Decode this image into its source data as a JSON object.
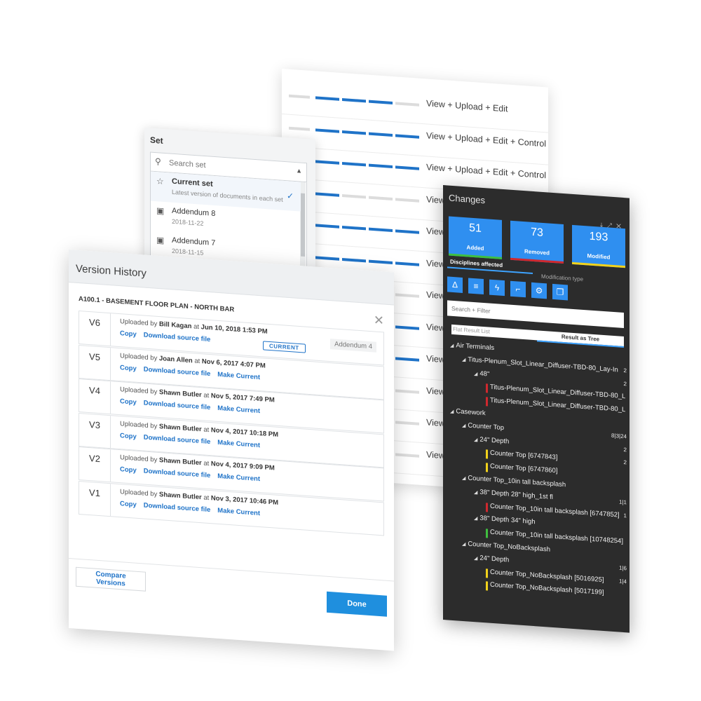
{
  "permissions": {
    "rows": [
      {
        "label": "View + Upload + Edit",
        "level": 0.75
      },
      {
        "label": "View + Upload + Edit + Control",
        "level": 1.0
      },
      {
        "label": "View + Upload + Edit + Control",
        "level": 1.0
      },
      {
        "label": "View",
        "level": 0.25
      },
      {
        "label": "View",
        "level": 1.0
      },
      {
        "label": "View",
        "level": 1.0
      },
      {
        "label": "View",
        "level": 0.5
      },
      {
        "label": "View",
        "level": 1.0
      },
      {
        "label": "View",
        "level": 1.0
      },
      {
        "label": "View",
        "level": 0.25
      },
      {
        "label": "View",
        "level": 0.5
      },
      {
        "label": "View",
        "level": 0.5
      }
    ]
  },
  "set_panel": {
    "title": "Set",
    "search_placeholder": "Search set",
    "items": [
      {
        "name": "Current set",
        "sub": "Latest version of documents in each set",
        "icon": "star-icon",
        "selected": true
      },
      {
        "name": "Addendum 8",
        "sub": "2018-11-22",
        "icon": "document-stack-icon",
        "selected": false
      },
      {
        "name": "Addendum 7",
        "sub": "2018-11-15",
        "icon": "document-stack-icon",
        "selected": false
      }
    ]
  },
  "version_history": {
    "title": "Version History",
    "file_name": "A100.1 - BASEMENT FLOOR PLAN - NORTH BAR",
    "versions": [
      {
        "v": "V6",
        "prefix": "Uploaded by",
        "user": "Bill Kagan",
        "at": "at",
        "date": "Jun 10, 2018 1:53 PM",
        "copy": "Copy",
        "download": "Download source file",
        "make_current": "",
        "badge": "CURRENT",
        "addendum": "Addendum 4"
      },
      {
        "v": "V5",
        "prefix": "Uploaded by",
        "user": "Joan Allen",
        "at": "at",
        "date": "Nov 6, 2017 4:07 PM",
        "copy": "Copy",
        "download": "Download source file",
        "make_current": "Make Current",
        "badge": "",
        "addendum": ""
      },
      {
        "v": "V4",
        "prefix": "Uploaded by",
        "user": "Shawn Butler",
        "at": "at",
        "date": "Nov 5, 2017 7:49 PM",
        "copy": "Copy",
        "download": "Download source file",
        "make_current": "Make Current",
        "badge": "",
        "addendum": ""
      },
      {
        "v": "V3",
        "prefix": "Uploaded by",
        "user": "Shawn Butler",
        "at": "at",
        "date": "Nov 4, 2017 10:18 PM",
        "copy": "Copy",
        "download": "Download source file",
        "make_current": "Make Current",
        "badge": "",
        "addendum": ""
      },
      {
        "v": "V2",
        "prefix": "Uploaded by",
        "user": "Shawn Butler",
        "at": "at",
        "date": "Nov 4, 2017 9:09 PM",
        "copy": "Copy",
        "download": "Download source file",
        "make_current": "Make Current",
        "badge": "",
        "addendum": ""
      },
      {
        "v": "V1",
        "prefix": "Uploaded by",
        "user": "Shawn Butler",
        "at": "at",
        "date": "Nov 3, 2017 10:46 PM",
        "copy": "Copy",
        "download": "Download source file",
        "make_current": "Make Current",
        "badge": "",
        "addendum": ""
      }
    ],
    "compare_label": "Compare Versions",
    "done_label": "Done"
  },
  "changes": {
    "title": "Changes",
    "stats": [
      {
        "value": "51",
        "label": "Added",
        "color": "#3fbf3f"
      },
      {
        "value": "73",
        "label": "Removed",
        "color": "#d0282e"
      },
      {
        "value": "193",
        "label": "Modified",
        "color": "#f2d21b"
      }
    ],
    "tabs": {
      "disciplines": "Disciplines affected",
      "modification": "Modification type"
    },
    "discipline_icons": [
      "architecture-icon",
      "structure-icon",
      "electrical-icon",
      "plumbing-icon",
      "mechanical-icon",
      "fire-protection-icon"
    ],
    "search_placeholder": "Search + Filter",
    "result_tabs": {
      "flat": "Flat Result List",
      "tree": "Result as Tree"
    },
    "tree": [
      {
        "label": "Air Terminals",
        "indent": 0,
        "arrow": true,
        "marker": "",
        "count": ""
      },
      {
        "label": "Titus-Plenum_Slot_Linear_Diffuser-TBD-80_Lay-In",
        "indent": 1,
        "arrow": true,
        "marker": "",
        "count": "2"
      },
      {
        "label": "48\"",
        "indent": 2,
        "arrow": true,
        "marker": "",
        "count": "2"
      },
      {
        "label": "Titus-Plenum_Slot_Linear_Diffuser-TBD-80_L",
        "indent": 3,
        "arrow": false,
        "marker": "#d0282e",
        "count": ""
      },
      {
        "label": "Titus-Plenum_Slot_Linear_Diffuser-TBD-80_L",
        "indent": 3,
        "arrow": false,
        "marker": "#d0282e",
        "count": ""
      },
      {
        "label": "Casework",
        "indent": 0,
        "arrow": true,
        "marker": "",
        "count": ""
      },
      {
        "label": "Counter Top",
        "indent": 1,
        "arrow": true,
        "marker": "",
        "count": "8|3|24"
      },
      {
        "label": "24\" Depth",
        "indent": 2,
        "arrow": true,
        "marker": "",
        "count": "2"
      },
      {
        "label": "Counter Top [6747843]",
        "indent": 3,
        "arrow": false,
        "marker": "#f2d21b",
        "count": "2"
      },
      {
        "label": "Counter Top [6747860]",
        "indent": 3,
        "arrow": false,
        "marker": "#f2d21b",
        "count": ""
      },
      {
        "label": "Counter Top_10in tall backsplash",
        "indent": 1,
        "arrow": true,
        "marker": "",
        "count": ""
      },
      {
        "label": "38\" Depth 28\" high_1st fl",
        "indent": 2,
        "arrow": true,
        "marker": "",
        "count": "1|1"
      },
      {
        "label": "Counter Top_10in tall backsplash [6747852]",
        "indent": 3,
        "arrow": false,
        "marker": "#d0282e",
        "count": "1"
      },
      {
        "label": "38\" Depth 34\" high",
        "indent": 2,
        "arrow": true,
        "marker": "",
        "count": ""
      },
      {
        "label": "Counter Top_10in tall backsplash [10748254]",
        "indent": 3,
        "arrow": false,
        "marker": "#3fbf3f",
        "count": ""
      },
      {
        "label": "Counter Top_NoBacksplash",
        "indent": 1,
        "arrow": true,
        "marker": "",
        "count": ""
      },
      {
        "label": "24\" Depth",
        "indent": 2,
        "arrow": true,
        "marker": "",
        "count": "1|6"
      },
      {
        "label": "Counter Top_NoBacksplash [5016925]",
        "indent": 3,
        "arrow": false,
        "marker": "#f2d21b",
        "count": "1|4"
      },
      {
        "label": "Counter Top_NoBacksplash [5017199]",
        "indent": 3,
        "arrow": false,
        "marker": "#f2d21b",
        "count": ""
      }
    ]
  }
}
